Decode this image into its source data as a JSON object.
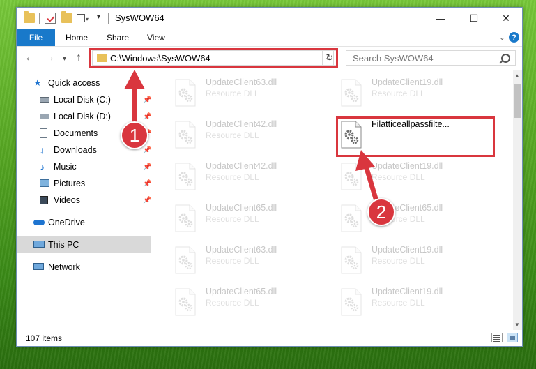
{
  "window": {
    "title": "SysWOW64",
    "controls": {
      "minimize": "—",
      "maximize": "☐",
      "close": "✕"
    }
  },
  "ribbon": {
    "tabs": [
      "File",
      "Home",
      "Share",
      "View"
    ],
    "help": "?",
    "collapse_icon": "chevron-down-icon"
  },
  "navigation": {
    "back": "←",
    "forward": "→",
    "recent": "▾",
    "up": "↑",
    "address": "C:\\Windows\\SysWOW64",
    "refresh": "↻",
    "search_placeholder": "Search SysWOW64"
  },
  "sidebar": {
    "items": [
      {
        "label": "Quick access",
        "icon": "star-icon",
        "pinned": false
      },
      {
        "label": "Local Disk (C:)",
        "icon": "drive-icon",
        "pinned": true
      },
      {
        "label": "Local Disk (D:)",
        "icon": "drive-icon",
        "pinned": true
      },
      {
        "label": "Documents",
        "icon": "documents-icon",
        "pinned": true
      },
      {
        "label": "Downloads",
        "icon": "downloads-icon",
        "pinned": true
      },
      {
        "label": "Music",
        "icon": "music-icon",
        "pinned": true
      },
      {
        "label": "Pictures",
        "icon": "pictures-icon",
        "pinned": true
      },
      {
        "label": "Videos",
        "icon": "videos-icon",
        "pinned": true
      },
      {
        "label": "OneDrive",
        "icon": "cloud-icon",
        "pinned": false
      },
      {
        "label": "This PC",
        "icon": "computer-icon",
        "pinned": false,
        "selected": true
      },
      {
        "label": "Network",
        "icon": "network-icon",
        "pinned": false
      }
    ]
  },
  "files": {
    "left_column": [
      {
        "name": "UpdateClient63.dll",
        "desc": "Resource DLL"
      },
      {
        "name": "UpdateClient42.dll",
        "desc": "Resource DLL"
      },
      {
        "name": "UpdateClient42.dll",
        "desc": "Resource DLL"
      },
      {
        "name": "UpdateClient65.dll",
        "desc": "Resource DLL"
      },
      {
        "name": "UpdateClient63.dll",
        "desc": "Resource DLL"
      },
      {
        "name": "UpdateClient65.dll",
        "desc": "Resource DLL"
      }
    ],
    "right_column": [
      {
        "name": "UpdateClient19.dll",
        "desc": "Resource DLL"
      },
      {
        "name": "Filatticeallpassfilte...",
        "desc": "",
        "highlight": true
      },
      {
        "name": "UpdateClient19.dll",
        "desc": "Resource DLL"
      },
      {
        "name": "UpdateClient65.dll",
        "desc": "Resource DLL"
      },
      {
        "name": "UpdateClient19.dll",
        "desc": "Resource DLL"
      },
      {
        "name": "UpdateClient19.dll",
        "desc": "Resource DLL"
      }
    ]
  },
  "status": {
    "item_count": "107 items"
  },
  "annotations": {
    "step1": "1",
    "step2": "2",
    "color": "#d9363e"
  }
}
